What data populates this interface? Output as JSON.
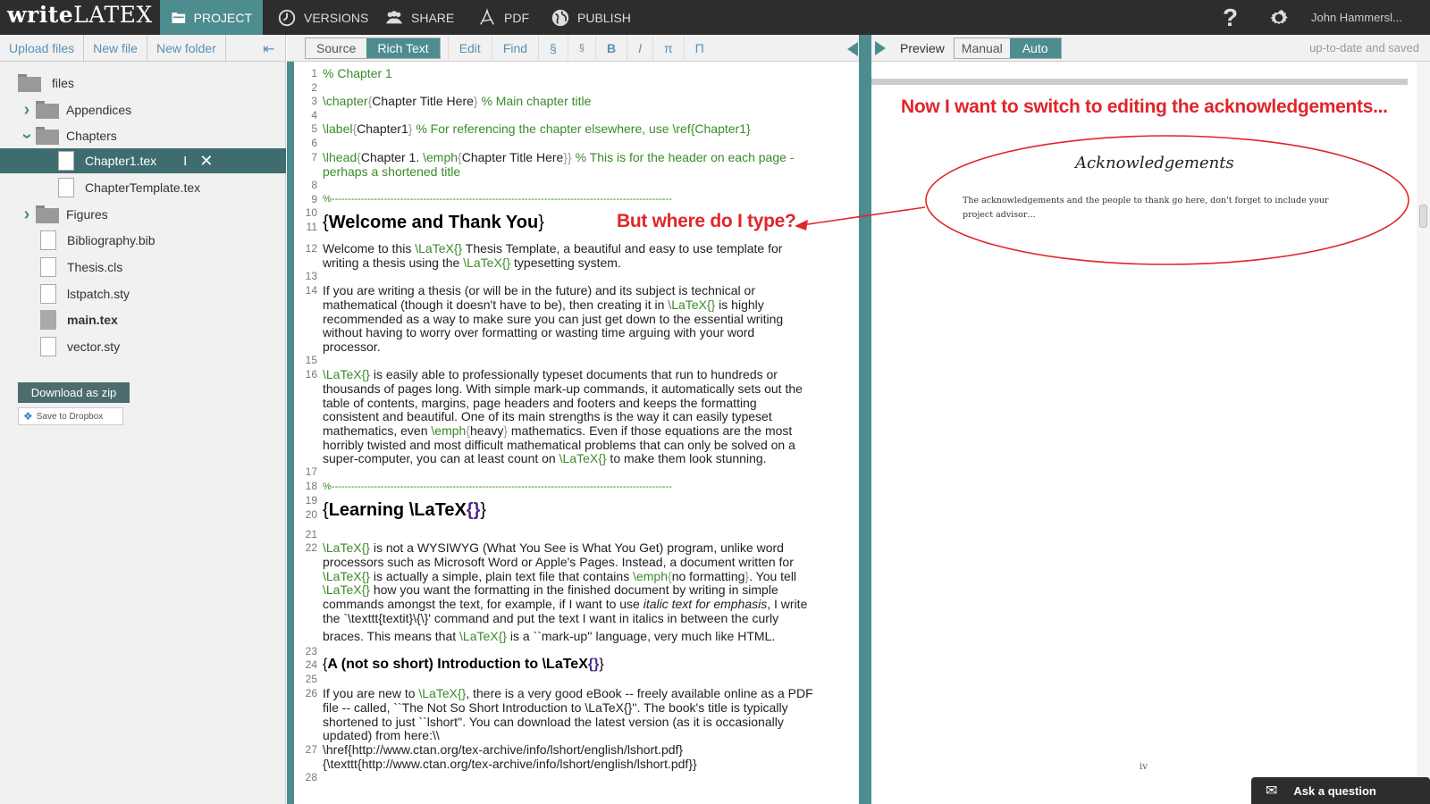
{
  "app": {
    "logo_write": "write",
    "logo_latex": "LATEX"
  },
  "nav": {
    "project": "PROJECT",
    "versions": "VERSIONS",
    "share": "SHARE",
    "pdf": "PDF",
    "publish": "PUBLISH",
    "help": "?",
    "user": "John Hammersl..."
  },
  "sidebar": {
    "upload": "Upload files",
    "new_file": "New file",
    "new_folder": "New folder",
    "items": {
      "files": "files",
      "appendices": "Appendices",
      "chapters": "Chapters",
      "chapter1": "Chapter1.tex",
      "chapter_template": "ChapterTemplate.tex",
      "figures": "Figures",
      "bibliography": "Bibliography.bib",
      "thesis_cls": "Thesis.cls",
      "lstpatch": "lstpatch.sty",
      "main": "main.tex",
      "vector": "vector.sty"
    },
    "download_zip": "Download as zip",
    "save_dropbox": "Save to Dropbox"
  },
  "editor": {
    "source": "Source",
    "rich_text": "Rich Text",
    "edit": "Edit",
    "find": "Find",
    "section": "§",
    "subsection": "§",
    "bold": "B",
    "italic": "I",
    "pi": "π",
    "pilcrow": "Π",
    "line_numbers": [
      "1",
      "2",
      "3",
      "4",
      "5",
      "6",
      "7",
      "8",
      "9",
      "10",
      "11",
      "12",
      "13",
      "14",
      "15",
      "16",
      "17",
      "18",
      "19",
      "20",
      "21",
      "22",
      "23",
      "24",
      "25",
      "26",
      "27",
      "28"
    ],
    "lines": {
      "l1": "% Chapter 1",
      "l3_cmd": "\\chapter",
      "l3_arg": "Chapter Title Here",
      "l3_cmt": "% Main chapter title",
      "l5_cmd": "\\label",
      "l5_arg": "Chapter1",
      "l5_cmt": "% For referencing the chapter elsewhere, use \\ref{Chapter1}",
      "l7_cmd": "\\lhead",
      "l7_a": "Chapter 1. ",
      "l7_cmd2": "\\emph",
      "l7_arg": "Chapter Title Here",
      "l7_cmt": "% This is for the header on each page -",
      "l7_cmt2": "perhaps a shortened title",
      "l9": "%--------------------------------------------------------------------------------------------------------",
      "l11": "Welcome and Thank You",
      "l12a": "Welcome to this ",
      "l12b": " Thesis Template, a beautiful and easy to use template for",
      "l12c": "writing a thesis using the ",
      "l12d": " typesetting system.",
      "latex_cmd": "\\LaTeX{}",
      "l14_1": "If you are writing a thesis (or will be in the future) and its subject is technical or",
      "l14_2": "mathematical (though it doesn't have to be), then creating it in ",
      "l14_2b": " is highly",
      "l14_3": "recommended as a way to make sure you can just get down to the essential writing",
      "l14_4": "without having to worry over formatting or wasting time arguing with your word",
      "l14_5": "processor.",
      "l16_1b": " is easily able to professionally typeset documents that run to hundreds or",
      "l16_2": "thousands of pages long. With simple mark-up commands, it automatically sets out the",
      "l16_3": "table of contents, margins, page headers and footers and keeps the formatting",
      "l16_4": "consistent and beautiful. One of its main strengths is the way it can easily typeset",
      "l16_5a": "mathematics, even ",
      "l16_5cmd": "\\emph",
      "l16_5arg": "heavy",
      "l16_5b": " mathematics. Even if those equations are the most",
      "l16_6": "horribly twisted and most difficult mathematical problems that can only be solved on a",
      "l16_7a": "super-computer, you can at least count on ",
      "l16_7b": " to make them look stunning.",
      "l18": "%--------------------------------------------------------------------------------------------------------",
      "l20a": "Learning ",
      "l20b": "\\LaTeX",
      "l20c": "{}",
      "l22_1b": " is not a WYSIWYG (What You See is What You Get) program, unlike word",
      "l22_2": "processors such as Microsoft Word or Apple's Pages. Instead, a document written for",
      "l22_3b": " is actually a simple, plain text file that contains ",
      "l22_3cmd": "\\emph",
      "l22_3arg": "no formatting",
      "l22_3c": ". You tell",
      "l22_4b": " how you want the formatting in the finished document by writing in simple",
      "l22_5a": "commands amongst the text, for example, if I want to use ",
      "l22_5it": "italic text for emphasis",
      "l22_5b": ", I write",
      "l22_6": "the `\\texttt{textit}\\{\\}' command and put the text I want in italics in between the curly",
      "l22_7a": "braces. This means that ",
      "l22_7b": " is a ``mark-up'' language, very much like HTML.",
      "l24a": "A (not so short) Introduction to ",
      "l24b": "\\LaTeX",
      "l24c": "{}",
      "l26_1a": "If you are new to ",
      "l26_1b": ", there is a very good eBook -- freely available online as a PDF",
      "l26_2": "file -- called, ``The Not So Short Introduction to \\LaTeX{}''. The book's title is typically",
      "l26_3": "shortened to just ``lshort''. You can download the latest version (as it is occasionally",
      "l26_4": "updated) from here:\\\\",
      "l27_1": "\\href{http://www.ctan.org/tex-archive/info/lshort/english/lshort.pdf}",
      "l27_2": "{\\texttt{http://www.ctan.org/tex-archive/info/lshort/english/lshort.pdf}}"
    }
  },
  "preview": {
    "label": "Preview",
    "manual": "Manual",
    "auto": "Auto",
    "status": "up-to-date and saved",
    "ack_title": "Acknowledgements",
    "ack_body": "The acknowledgements and the people to thank go here, don't forget to include your project advisor…",
    "page_number": "iv"
  },
  "annotations": {
    "top": "Now I want to switch to editing the acknowledgements...",
    "mid": "But where do I type?"
  },
  "help_widget": {
    "ask": "Ask a question"
  },
  "colors": {
    "accent": "#4d8c8f",
    "topbar": "#2d2d2d",
    "annotation": "#e0252a",
    "latex_command": "#3a8a2a"
  }
}
